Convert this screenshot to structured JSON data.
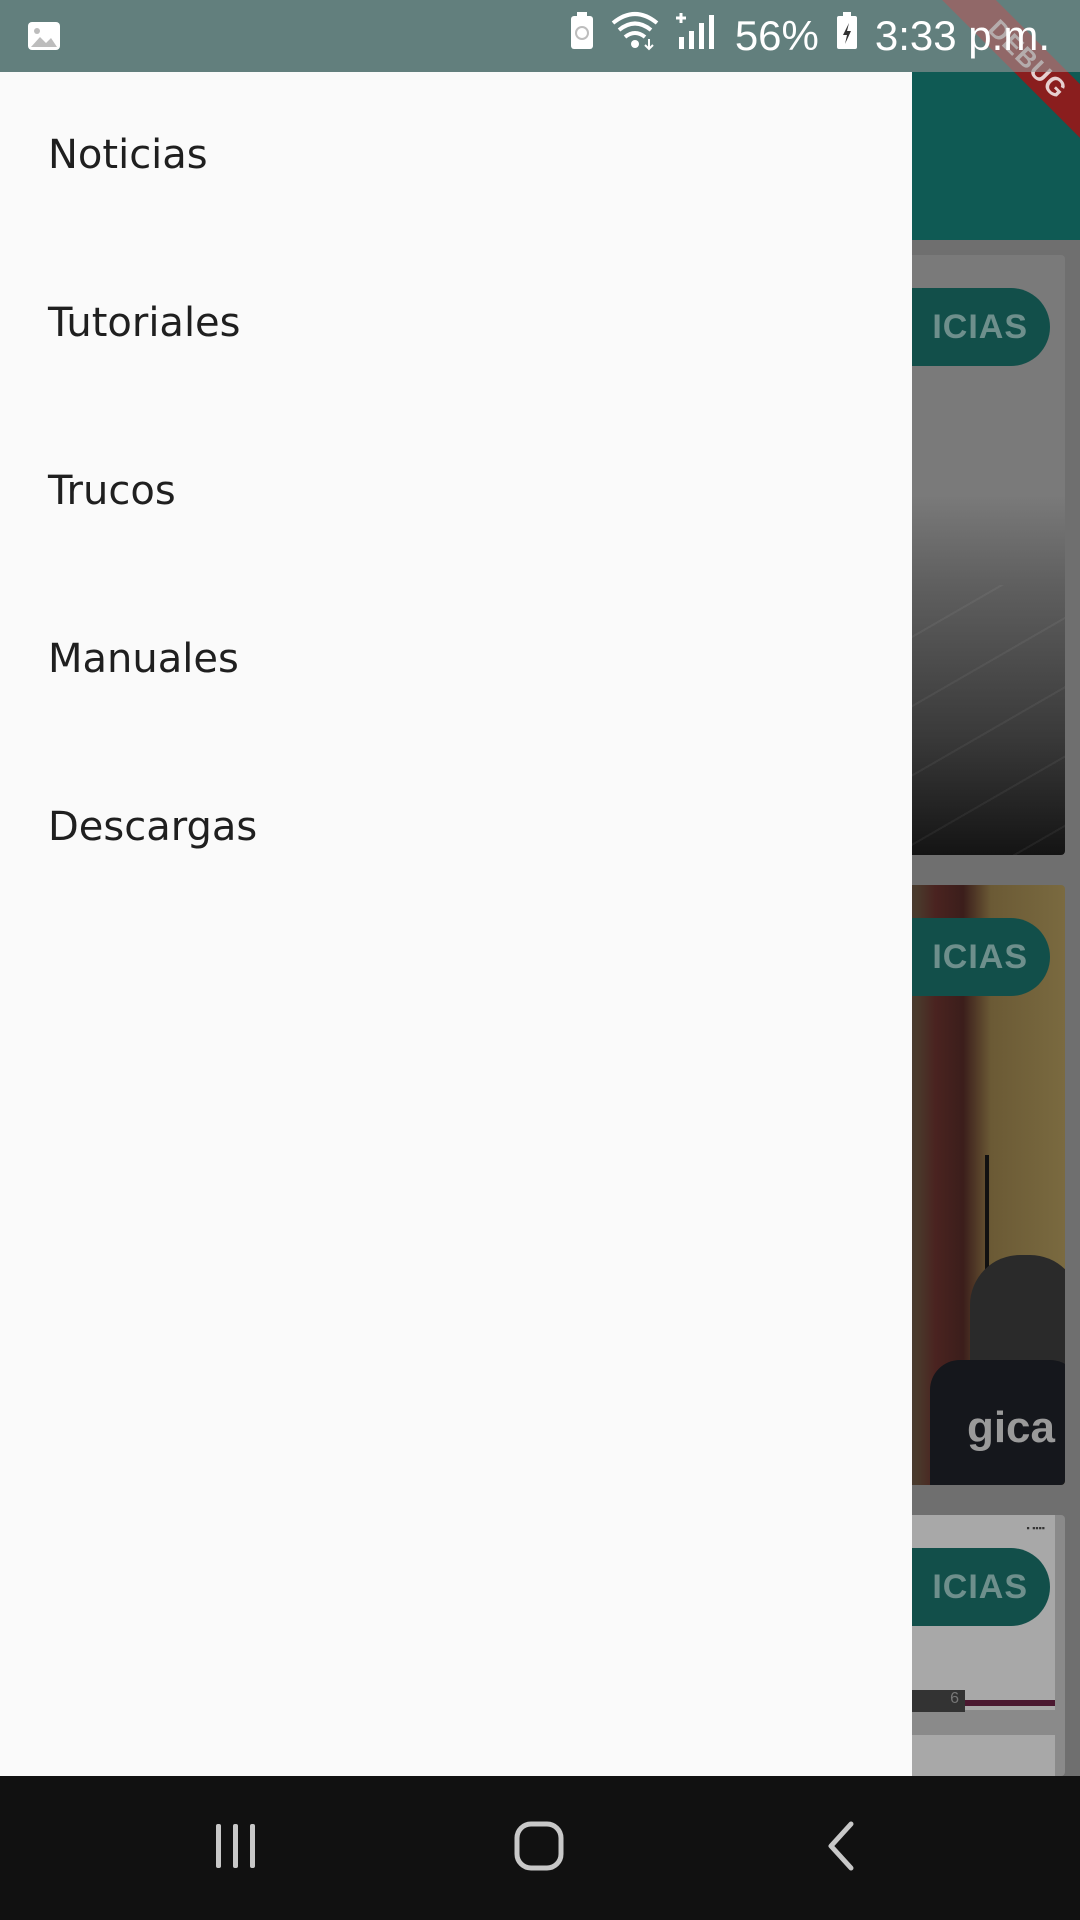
{
  "status_bar": {
    "battery_percent": "56%",
    "time": "3:33 p.m.",
    "icons": [
      "image-icon",
      "battery-saver-icon",
      "wifi-icon",
      "signal-icon",
      "battery-charging-icon"
    ]
  },
  "debug_banner": "DEBUG",
  "drawer": {
    "items": [
      {
        "label": "Noticias"
      },
      {
        "label": "Tutoriales"
      },
      {
        "label": "Trucos"
      },
      {
        "label": "Manuales"
      },
      {
        "label": "Descargas"
      }
    ]
  },
  "background": {
    "card_tags": [
      "ICIAS",
      "ICIAS",
      "ICIAS"
    ],
    "card_2_caption": "gica",
    "card_3_number": "6"
  },
  "colors": {
    "app_bar": "#0f5a54",
    "drawer_bg": "#fafafa",
    "nav_bar": "#111111",
    "debug_banner": "#8a1e1e"
  },
  "nav_bar": {
    "buttons": [
      "recents-icon",
      "home-icon",
      "back-icon"
    ]
  }
}
